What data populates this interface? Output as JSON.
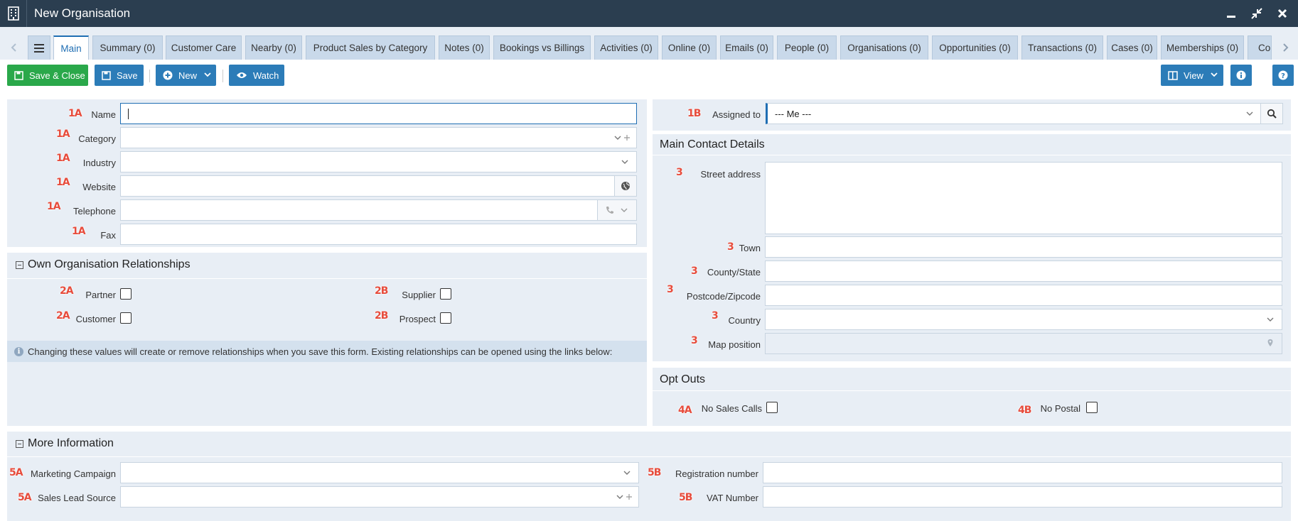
{
  "window": {
    "title": "New Organisation",
    "app_icon": "building-icon"
  },
  "tabs": [
    "Main",
    "Summary (0)",
    "Customer Care",
    "Nearby (0)",
    "Product Sales by Category",
    "Notes (0)",
    "Bookings vs Billings",
    "Activities (0)",
    "Online (0)",
    "Emails (0)",
    "People (0)",
    "Organisations (0)",
    "Opportunities (0)",
    "Transactions (0)",
    "Cases (0)",
    "Memberships (0)",
    "Co"
  ],
  "toolbar": {
    "save_close": "Save & Close",
    "save": "Save",
    "new": "New",
    "watch": "Watch",
    "view": "View"
  },
  "main_form": {
    "name_label": "Name",
    "category_label": "Category",
    "industry_label": "Industry",
    "website_label": "Website",
    "telephone_label": "Telephone",
    "fax_label": "Fax"
  },
  "assigned": {
    "label": "Assigned to",
    "value": "--- Me ---"
  },
  "own_relationships": {
    "title": "Own Organisation Relationships",
    "partner": "Partner",
    "customer": "Customer",
    "supplier": "Supplier",
    "prospect": "Prospect",
    "info": "Changing these values will create or remove relationships when you save this form. Existing relationships can be opened using the links below:"
  },
  "main_contact": {
    "title": "Main Contact Details",
    "street": "Street address",
    "town": "Town",
    "county": "County/State",
    "postcode": "Postcode/Zipcode",
    "country": "Country",
    "map": "Map position"
  },
  "opt_outs": {
    "title": "Opt Outs",
    "no_sales_calls": "No Sales Calls",
    "no_postal": "No Postal"
  },
  "more_info": {
    "title": "More Information",
    "marketing_campaign": "Marketing Campaign",
    "sales_lead_source": "Sales Lead Source",
    "registration_number": "Registration number",
    "vat_number": "VAT Number"
  },
  "badges": {
    "b1a": "1A",
    "b1b": "1B",
    "b2a": "2A",
    "b2b": "2B",
    "b3": "3",
    "b4a": "4A",
    "b4b": "4B",
    "b5a": "5A",
    "b5b": "5B"
  },
  "colors": {
    "titlebar": "#2b3e50",
    "accent": "#2c7cb8",
    "save_close": "#2aa84a",
    "panel": "#e8eef5",
    "tab": "#c9d9ea",
    "badge": "#e74c3c"
  }
}
